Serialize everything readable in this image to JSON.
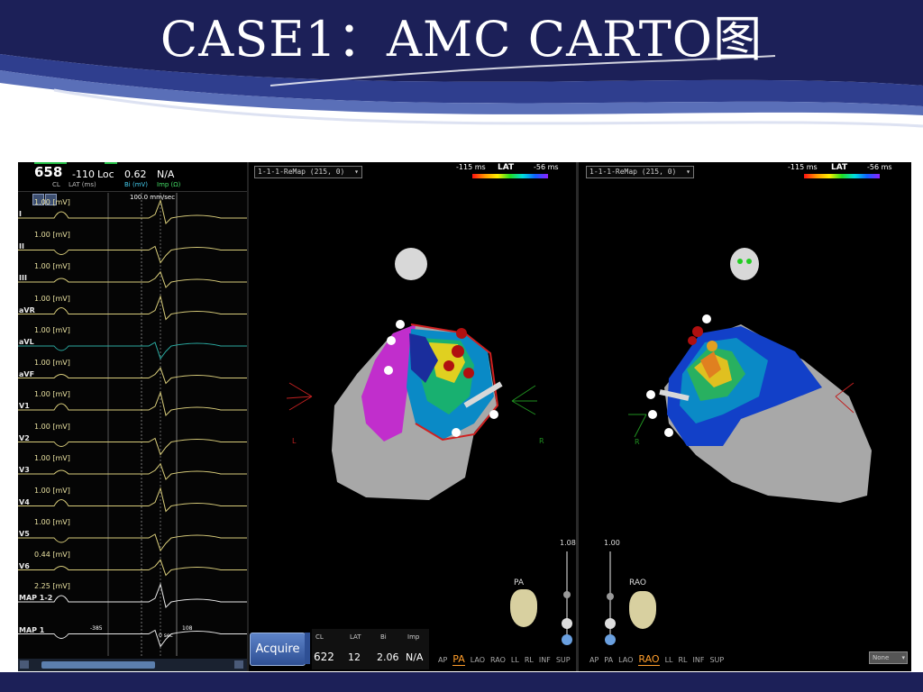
{
  "slide": {
    "title": "CASE1：AMC CARTO图",
    "colors": {
      "navy": "#1c2058",
      "ribbon": "#2e3d8c"
    }
  },
  "ecg": {
    "cl_value": "658",
    "cl_label": "CL",
    "lat_value": "-110",
    "lat_label": "LAT (ms)",
    "loc_label": "Loc",
    "bi_value": "0.62",
    "bi_label": "Bi (mV)",
    "imp_value": "N/A",
    "imp_label": "Imp (Ω)",
    "sweep_speed": "100.0 mm/sec",
    "tool_icons": [
      "cursor-icon",
      "caliper-icon"
    ],
    "leads": [
      {
        "name": "I",
        "gain": "1.00 [mV]"
      },
      {
        "name": "II",
        "gain": "1.00 [mV]"
      },
      {
        "name": "III",
        "gain": "1.00 [mV]"
      },
      {
        "name": "aVR",
        "gain": "1.00 [mV]"
      },
      {
        "name": "aVL",
        "gain": "1.00 [mV]"
      },
      {
        "name": "aVF",
        "gain": "1.00 [mV]"
      },
      {
        "name": "V1",
        "gain": "1.00 [mV]"
      },
      {
        "name": "V2",
        "gain": "1.00 [mV]"
      },
      {
        "name": "V3",
        "gain": "1.00 [mV]"
      },
      {
        "name": "V4",
        "gain": "1.00 [mV]"
      },
      {
        "name": "V5",
        "gain": "1.00 [mV]"
      },
      {
        "name": "V6",
        "gain": "0.44 [mV]"
      },
      {
        "name": "MAP 1-2",
        "gain": "2.25 [mV]"
      },
      {
        "name": "MAP 1",
        "gain": ""
      }
    ],
    "window_start": "-385",
    "window_end": "108",
    "zero_label": "0 sec"
  },
  "map_left": {
    "selector": "1-1-1-ReMap (215, 0)",
    "scale_min": "-115 ms",
    "scale_max": "-56 ms",
    "scale_name": "LAT",
    "zoom_value": "1.08",
    "view_icon_label": "PA",
    "views": [
      "AP",
      "PA",
      "LAO",
      "RAO",
      "LL",
      "RL",
      "INF",
      "SUP"
    ],
    "active_view": "PA"
  },
  "map_right": {
    "selector": "1-1-1-ReMap (215, 0)",
    "scale_min": "-115 ms",
    "scale_max": "-56 ms",
    "scale_name": "LAT",
    "zoom_value": "1.00",
    "view_icon_label": "RAO",
    "views": [
      "AP",
      "PA",
      "LAO",
      "RAO",
      "LL",
      "RL",
      "INF",
      "SUP"
    ],
    "active_view": "RAO",
    "corner_dropdown": "None"
  },
  "status": {
    "acquire_label": "Acquire",
    "cl_label": "CL",
    "cl_value": "622",
    "lat_label": "LAT",
    "lat_value": "12",
    "bi_label": "Bi",
    "bi_value": "2.06",
    "imp_label": "Imp",
    "imp_value": "N/A"
  }
}
